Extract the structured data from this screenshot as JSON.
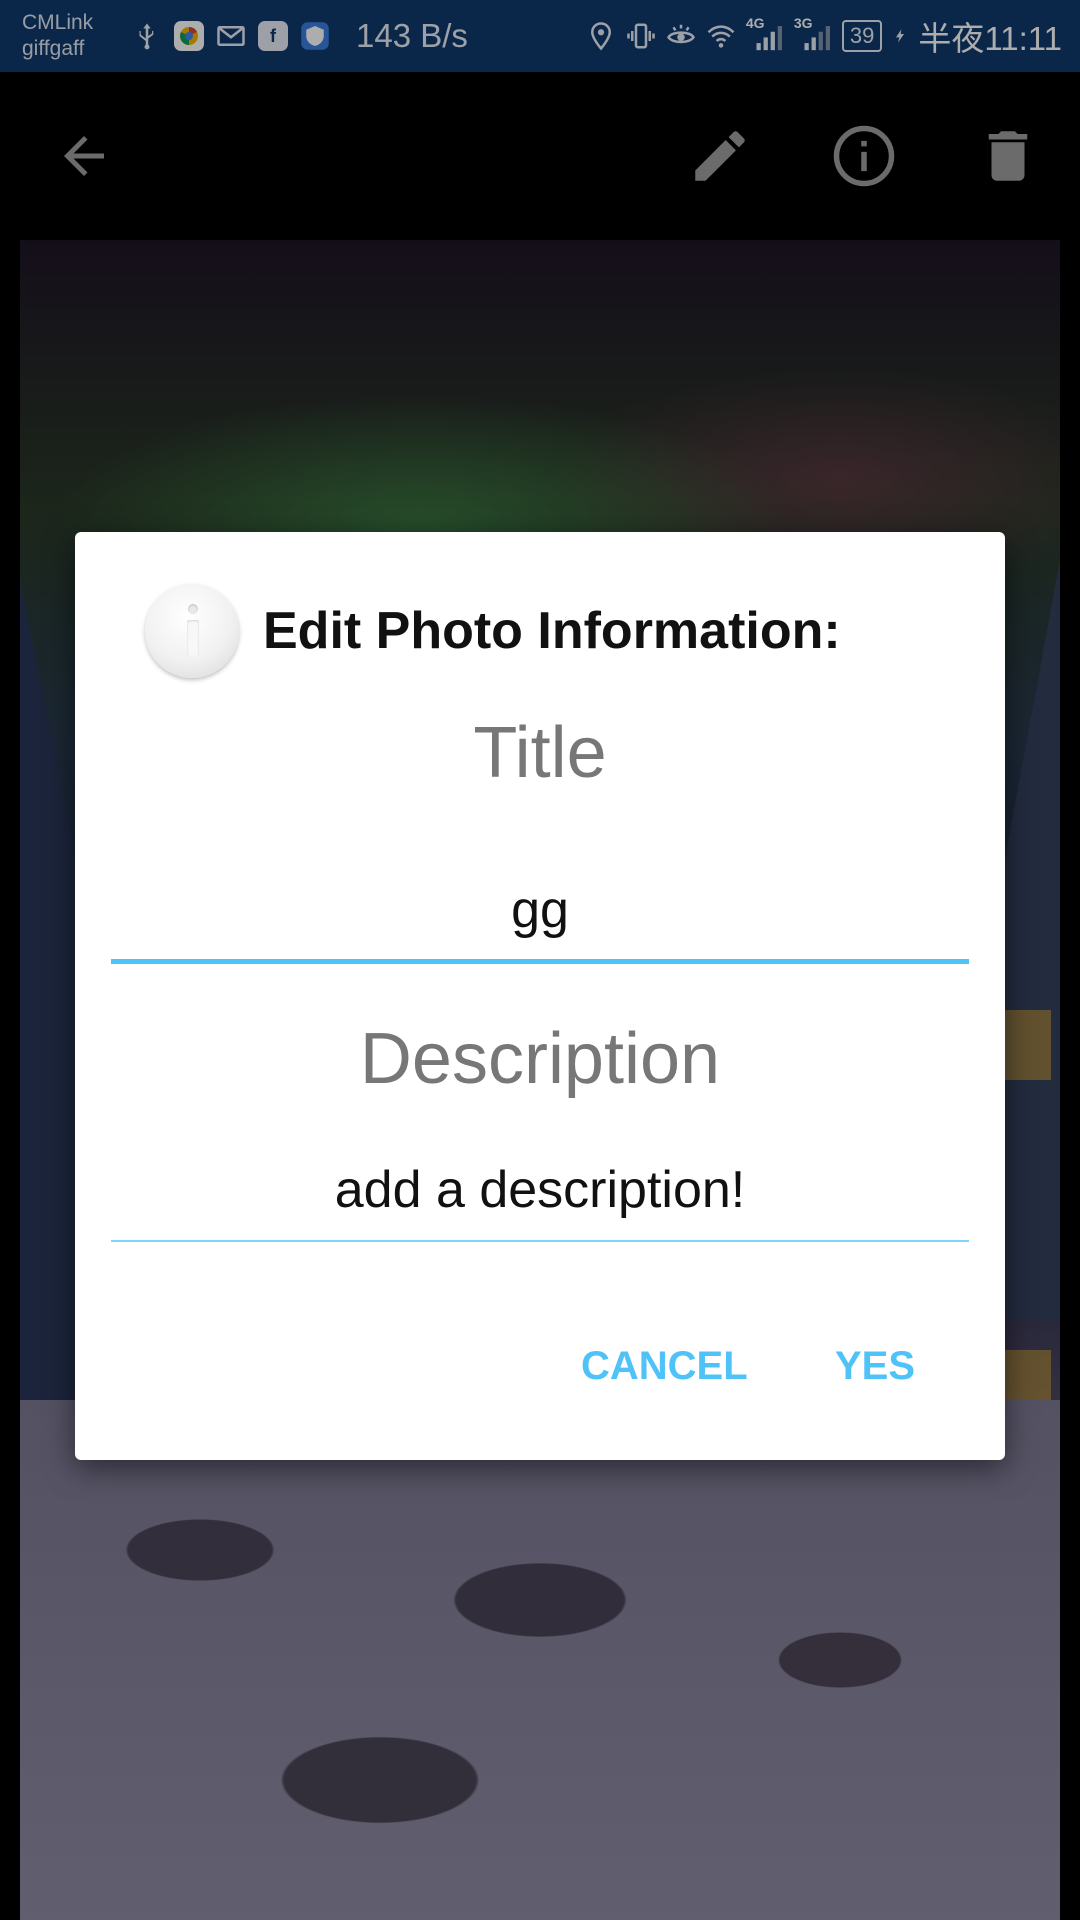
{
  "status_bar": {
    "carrier_1": "CMLink",
    "carrier_2": "giffgaff",
    "net_speed": "143 B/s",
    "net_4g": "4G",
    "net_3g": "3G",
    "battery": "39",
    "time": "半夜11:11",
    "icons": [
      "usb-icon",
      "browser-app-icon",
      "gmail-icon",
      "facebook-icon",
      "shield-app-icon",
      "location-icon",
      "vibrate-icon",
      "eye-comfort-icon",
      "wifi-icon",
      "signal-4g-icon",
      "signal-3g-icon",
      "battery-icon",
      "charging-icon"
    ]
  },
  "toolbar": {
    "icons": [
      "back-arrow-icon",
      "edit-pencil-icon",
      "info-icon",
      "delete-trash-icon"
    ],
    "icon_color": "#9e9e9e"
  },
  "dialog": {
    "header_title": "Edit Photo Information:",
    "title_label": "Title",
    "title_value": "gg",
    "description_label": "Description",
    "description_placeholder": "add a description!",
    "cancel_label": "CANCEL",
    "yes_label": "YES",
    "accent_color": "#4fc3f7"
  }
}
